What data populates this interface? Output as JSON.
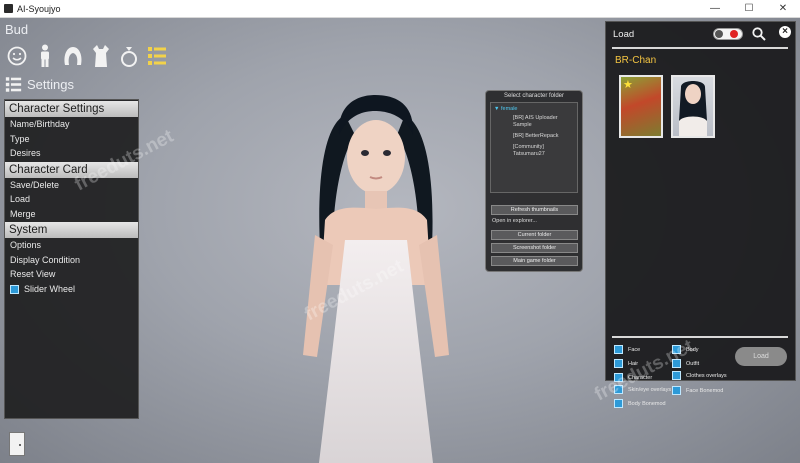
{
  "window": {
    "title": "AI-Syoujyo",
    "min_glyph": "—",
    "max_glyph": "☐",
    "close_glyph": "✕"
  },
  "mode_label": "Bud",
  "top_icons": [
    "smile-icon",
    "body-icon",
    "hair-icon",
    "outfit-icon",
    "ring-icon",
    "list-icon"
  ],
  "settings_header": {
    "label": "Settings"
  },
  "left_menu": {
    "character_settings": {
      "title": "Character Settings",
      "items": [
        "Name/Birthday",
        "Type",
        "Desires"
      ]
    },
    "character_card": {
      "title": "Character Card",
      "items": [
        "Save/Delete",
        "Load",
        "Merge"
      ]
    },
    "system": {
      "title": "System",
      "items": [
        "Options",
        "Display Condition",
        "Reset View"
      ],
      "checkbox": {
        "label": "Slider Wheel",
        "checked": true
      }
    }
  },
  "folder_dialog": {
    "title": "Select character folder",
    "root": "female",
    "children": [
      "[BR] AIS Uploader Sample",
      "[BR] BetterRepack",
      "[Community] Tatsumaru27"
    ],
    "refresh": "Refresh thumbnails",
    "open_explorer": "Open in explorer...",
    "current": "Current folder",
    "screenshot": "Screenshot folder",
    "main_game": "Main game folder"
  },
  "load_panel": {
    "title": "Load",
    "folder_name": "BR-Chan",
    "options": [
      {
        "label": "Face",
        "checked": true
      },
      {
        "label": "Body",
        "checked": true
      },
      {
        "label": "Hair",
        "checked": true
      },
      {
        "label": "Outfit",
        "checked": true
      },
      {
        "label": "Character",
        "checked": true
      },
      {
        "label": "Clothes overlays",
        "checked": true
      },
      {
        "label": "Skin/eye overlays",
        "checked": true
      },
      {
        "label": "Face Bonemod",
        "checked": true
      },
      {
        "label": "Body Bonemod",
        "checked": true
      }
    ],
    "load_button": "Load"
  },
  "watermarks": [
    "freeduts.net",
    "freeduts.net",
    "freeduts.net"
  ],
  "colors": {
    "accent_blue": "#2d9ad8",
    "folder_yellow": "#f4c542",
    "toggle_red": "#e02424"
  }
}
